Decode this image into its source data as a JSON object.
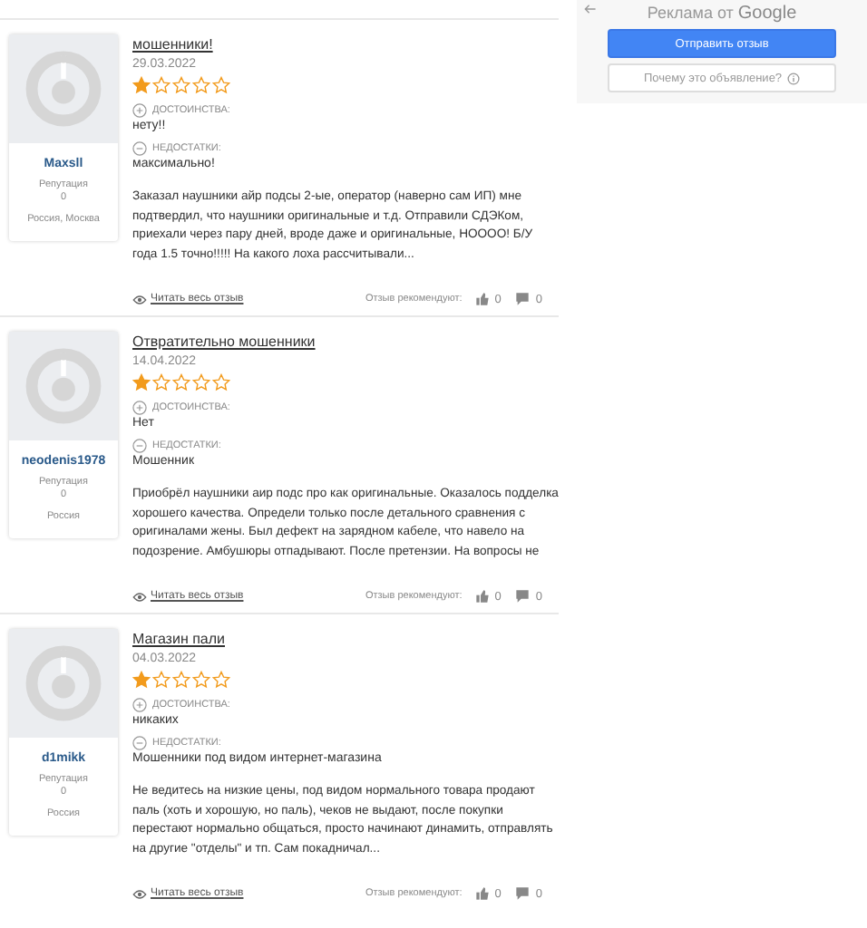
{
  "ad": {
    "label_prefix": "Реклама от",
    "label_brand": "Google",
    "primary_button": "Отправить отзыв",
    "secondary_button": "Почему это объявление?"
  },
  "reviews": [
    {
      "title": "мошенники!",
      "date": "29.03.2022",
      "stars": 1,
      "pros_label": "ДОСТОИНСТВА:",
      "pros": "нету!!",
      "cons_label": "НЕДОСТАТКИ:",
      "cons": "максимально!",
      "text": "Заказал наушники айр подсы 2-ые, оператор (наверно сам ИП) мне подтвердил, что наушники оригинальные и т.д. Отправили СДЭКом, приехали через пару дней, вроде даже и оригинальные, НОООО! Б/У года 1.5 точно!!!!! На какого лоха рассчитывали...",
      "read_more": "Читать весь отзыв",
      "recommend_label": "Отзыв рекомендуют:",
      "likes": "0",
      "comments": "0",
      "author": "Maxsll",
      "reputation_label": "Репутация",
      "reputation": "0",
      "location": "Россия, Москва"
    },
    {
      "title": "Отвратительно мошенники",
      "date": "14.04.2022",
      "stars": 1,
      "pros_label": "ДОСТОИНСТВА:",
      "pros": "Нет",
      "cons_label": "НЕДОСТАТКИ:",
      "cons": "Мошенник",
      "text": "Приобрёл наушники аир подс про как оригинальные. Оказалось подделка хорошего качества. Определи только после детального сравнения с оригиналами жены. Был дефект на зарядном кабеле, что навело на подозрение. Амбушюры отпадывают. После претензии. На вопросы не",
      "read_more": "Читать весь отзыв",
      "recommend_label": "Отзыв рекомендуют:",
      "likes": "0",
      "comments": "0",
      "author": "neodenis1978",
      "reputation_label": "Репутация",
      "reputation": "0",
      "location": "Россия"
    },
    {
      "title": "Магазин пали",
      "date": "04.03.2022",
      "stars": 1,
      "pros_label": "ДОСТОИНСТВА:",
      "pros": "никаких",
      "cons_label": "НЕДОСТАТКИ:",
      "cons": "Мошенники под видом интернет-магазина",
      "text": "Не ведитесь на низкие цены, под видом нормального товара продают паль (хоть и хорошую, но паль), чеков не выдают, после покупки перестают нормально общаться, просто начинают динамить, отправлять на другие \"отделы\" и тп. Сам покадничал...",
      "read_more": "Читать весь отзыв",
      "recommend_label": "Отзыв рекомендуют:",
      "likes": "0",
      "comments": "0",
      "author": "d1mikk",
      "reputation_label": "Репутация",
      "reputation": "0",
      "location": "Россия"
    }
  ]
}
